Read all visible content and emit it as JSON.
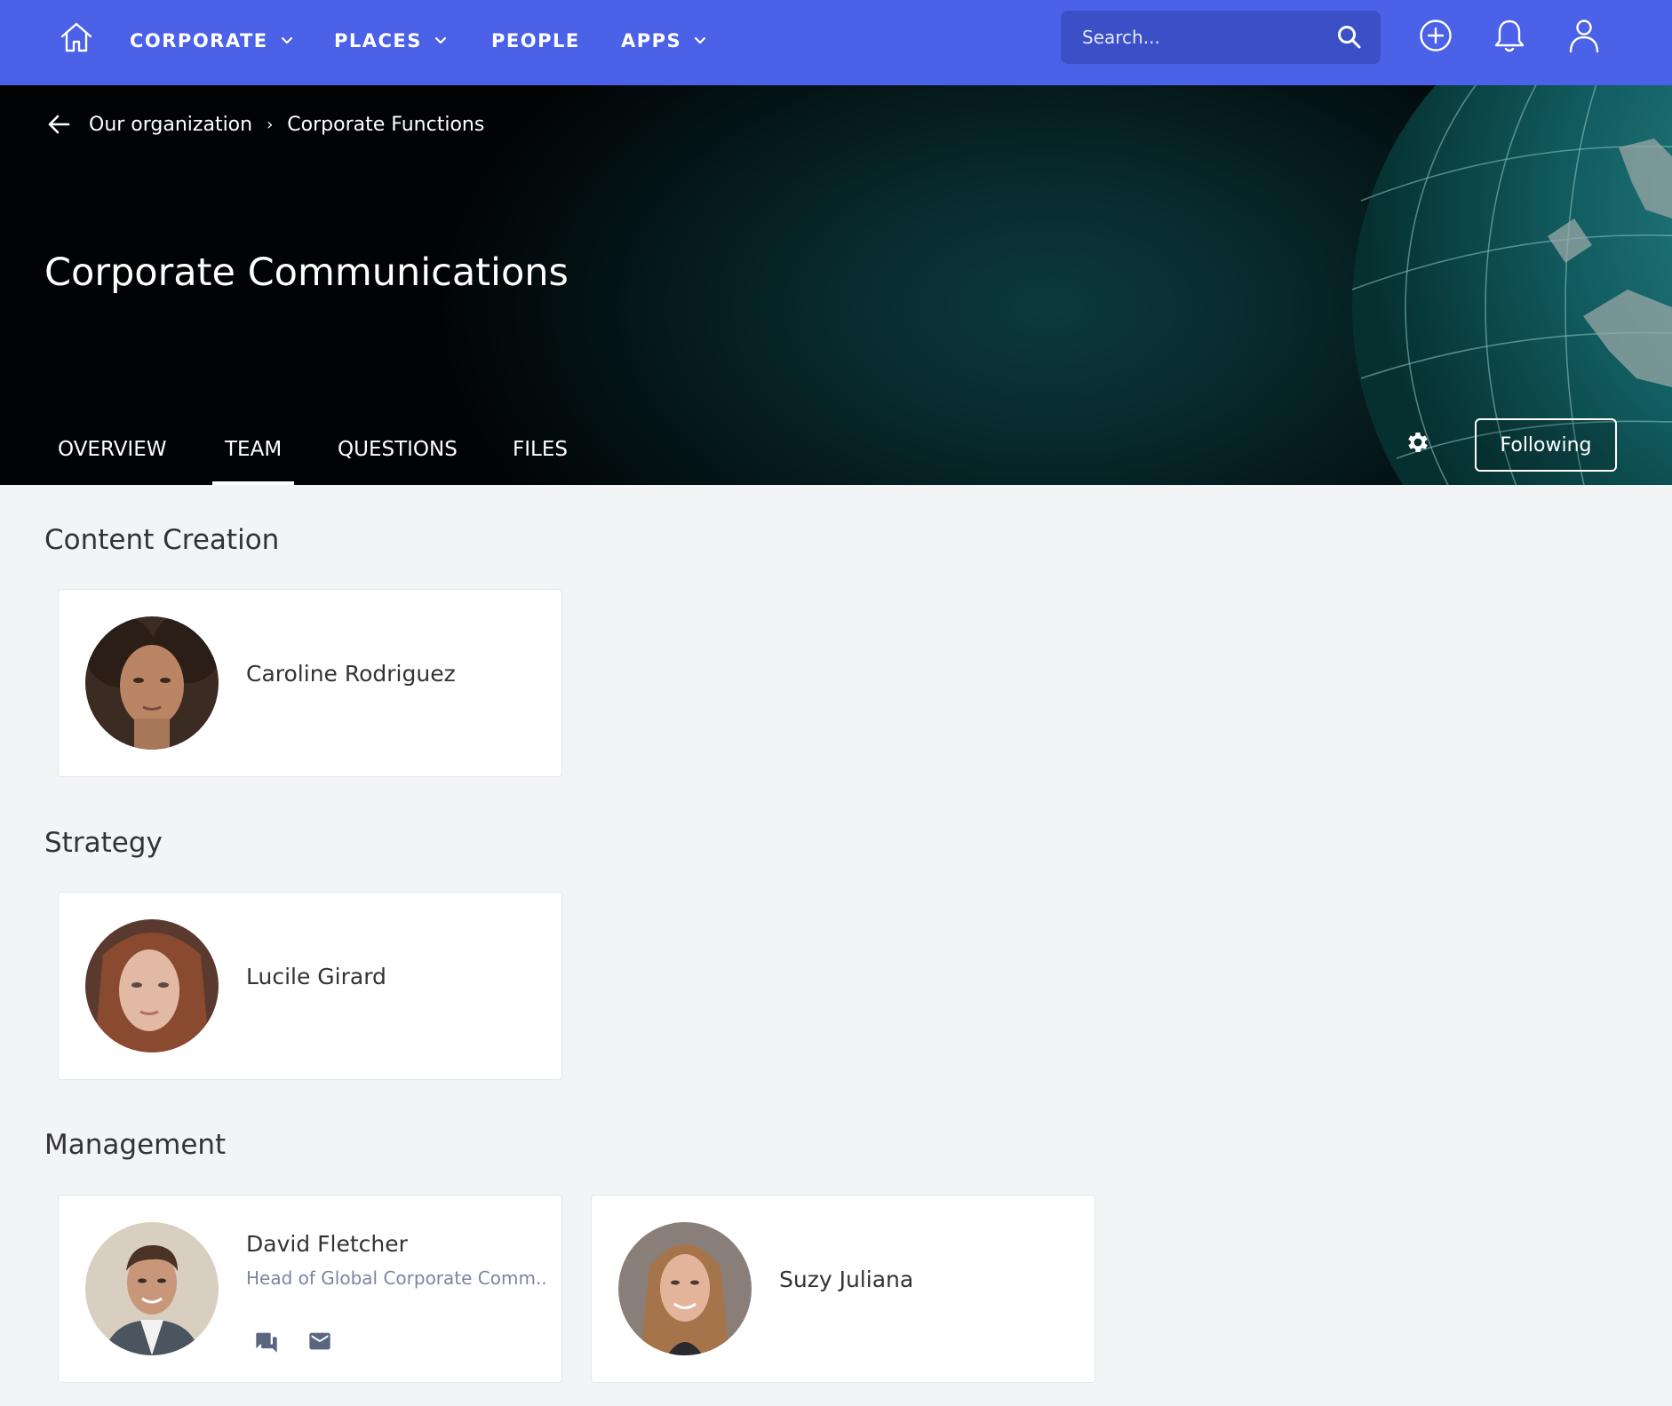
{
  "nav": {
    "items": [
      {
        "label": "CORPORATE",
        "has_dropdown": true
      },
      {
        "label": "PLACES",
        "has_dropdown": true
      },
      {
        "label": "PEOPLE",
        "has_dropdown": false
      },
      {
        "label": "APPS",
        "has_dropdown": true
      }
    ],
    "search": {
      "placeholder": "Search..."
    },
    "icons": [
      "home-icon",
      "search-icon",
      "add-circle-icon",
      "bell-icon",
      "user-icon"
    ]
  },
  "hero": {
    "breadcrumb": [
      "Our organization",
      "Corporate Functions"
    ],
    "title": "Corporate Communications",
    "tabs": [
      "OVERVIEW",
      "TEAM",
      "QUESTIONS",
      "FILES"
    ],
    "active_tab": "TEAM",
    "follow_label": "Following"
  },
  "sections": [
    {
      "title": "Content Creation",
      "members": [
        {
          "name": "Caroline Rodriguez"
        }
      ]
    },
    {
      "title": "Strategy",
      "members": [
        {
          "name": "Lucile Girard"
        }
      ]
    },
    {
      "title": "Management",
      "members": [
        {
          "name": "David Fletcher",
          "role": "Head of Global Corporate Comm..."
        },
        {
          "name": "Suzy Juliana"
        }
      ]
    }
  ],
  "colors": {
    "nav_bg": "#4a61e8",
    "search_bg": "#3b50c6",
    "page_bg": "#f3f4f6",
    "muted_text": "#7a86a0"
  }
}
